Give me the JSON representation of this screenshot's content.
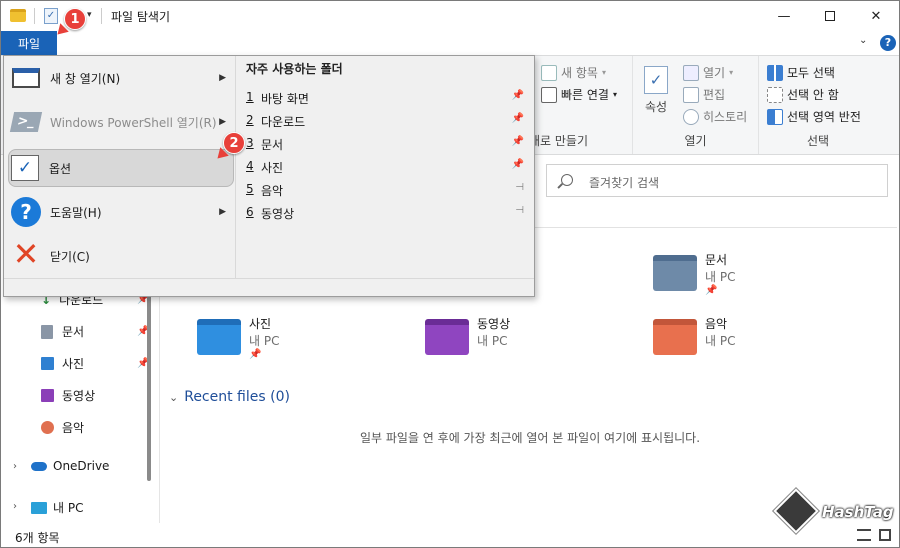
{
  "window": {
    "title": "파일 탐색기",
    "file_tab": "파일"
  },
  "ribbon": {
    "new_item": "새 항목",
    "easy_access": "빠른 연결",
    "new_group_label": "새로 만들기",
    "properties": "속성",
    "open": "열기",
    "edit": "편집",
    "history": "히스토리",
    "open_group_label": "열기",
    "select_all": "모두 선택",
    "select_none": "선택 안 함",
    "invert_selection": "선택 영역 반전",
    "select_group_label": "선택"
  },
  "search": {
    "placeholder": "즐겨찾기 검색"
  },
  "file_menu": {
    "items": [
      {
        "label": "새 창 열기(N)",
        "icon": "new-window-icon"
      },
      {
        "label": "Windows PowerShell 열기(R)",
        "icon": "powershell-icon"
      },
      {
        "label": "옵션",
        "icon": "checkmark-icon"
      },
      {
        "label": "도움말(H)",
        "icon": "help-icon"
      },
      {
        "label": "닫기(C)",
        "icon": "close-x-icon"
      }
    ],
    "frequent_header": "자주 사용하는 폴더",
    "frequent": [
      {
        "num": "1",
        "label": "바탕 화면"
      },
      {
        "num": "2",
        "label": "다운로드"
      },
      {
        "num": "3",
        "label": "문서"
      },
      {
        "num": "4",
        "label": "사진"
      },
      {
        "num": "5",
        "label": "음악"
      },
      {
        "num": "6",
        "label": "동영상"
      }
    ]
  },
  "badges": {
    "one": "1",
    "two": "2"
  },
  "nav": {
    "items": [
      {
        "label": "다운로드"
      },
      {
        "label": "문서"
      },
      {
        "label": "사진"
      },
      {
        "label": "동영상"
      },
      {
        "label": "음악"
      },
      {
        "label": "OneDrive"
      },
      {
        "label": "내 PC"
      }
    ]
  },
  "folders": [
    {
      "name": "문서",
      "sub": "내 PC"
    },
    {
      "name": "사진",
      "sub": "내 PC"
    },
    {
      "name": "동영상",
      "sub": "내 PC"
    },
    {
      "name": "음악",
      "sub": "내 PC"
    }
  ],
  "recent": {
    "header": "Recent files (0)",
    "empty_message": "일부 파일을 연 후에 가장 최근에 열어 본 파일이 여기에 표시됩니다."
  },
  "status": {
    "count": "6개 항목"
  },
  "watermark": {
    "text": "HashTag"
  }
}
